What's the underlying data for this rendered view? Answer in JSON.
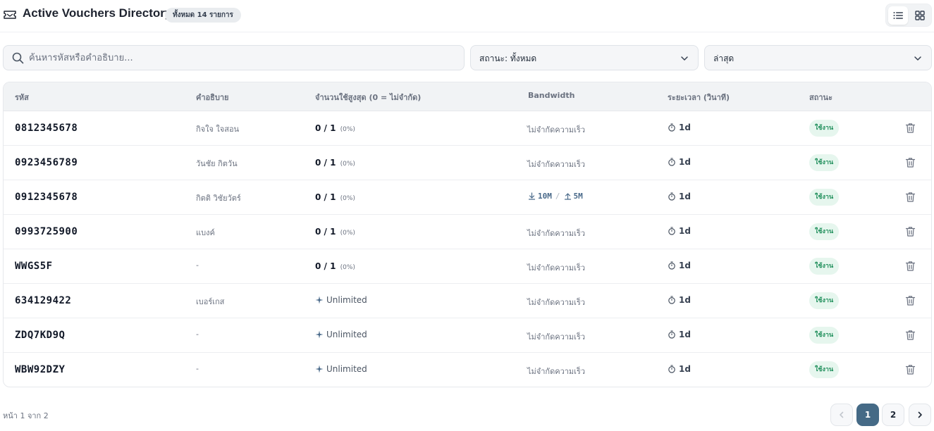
{
  "header": {
    "title": "Active Vouchers Directory",
    "count_badge": "ทั้งหมด 14 รายการ",
    "title_icon": "ticket-icon",
    "view_modes": [
      "list-view-icon",
      "grid-view-icon"
    ],
    "active_view": "list"
  },
  "filters": {
    "search_placeholder": "ค้นหารหัสหรือคำอธิบาย...",
    "search_value": "",
    "status_selected": "สถานะ: ทั้งหมด",
    "sort_selected": "ล่าสุด"
  },
  "table": {
    "columns": [
      "รหัส",
      "คำอธิบาย",
      "จำนวนใช้สูงสุด (0 = ไม่จำกัด)",
      "Bandwidth",
      "ระยะเวลา (วินาที)",
      "สถานะ"
    ],
    "rows": [
      {
        "code": "0812345678",
        "description": "กิจใจ ใจสอน",
        "usage": "0 / 1",
        "usage_pct": "(0%)",
        "bandwidth": "ไม่จำกัดความเร็ว",
        "duration": "1d",
        "status": "ใช้งาน"
      },
      {
        "code": "0923456789",
        "description": "วันชัย กิตวัน",
        "usage": "0 / 1",
        "usage_pct": "(0%)",
        "bandwidth": "ไม่จำกัดความเร็ว",
        "duration": "1d",
        "status": "ใช้งาน"
      },
      {
        "code": "0912345678",
        "description": "กิตติ วิชัยวัตร์",
        "usage": "0 / 1",
        "usage_pct": "(0%)",
        "bandwidth_down": "10M",
        "bandwidth_up": "5M",
        "duration": "1d",
        "status": "ใช้งาน"
      },
      {
        "code": "0993725900",
        "description": "แบงค์",
        "usage": "0 / 1",
        "usage_pct": "(0%)",
        "bandwidth": "ไม่จำกัดความเร็ว",
        "duration": "1d",
        "status": "ใช้งาน"
      },
      {
        "code": "WWGS5F",
        "description": "-",
        "usage": "0 / 1",
        "usage_pct": "(0%)",
        "bandwidth": "ไม่จำกัดความเร็ว",
        "duration": "1d",
        "status": "ใช้งาน"
      },
      {
        "code": "634129422",
        "description": "เบอร์เกส",
        "usage": "Unlimited",
        "bandwidth": "ไม่จำกัดความเร็ว",
        "duration": "1d",
        "status": "ใช้งาน"
      },
      {
        "code": "ZDQ7KD9Q",
        "description": "-",
        "usage": "Unlimited",
        "bandwidth": "ไม่จำกัดความเร็ว",
        "duration": "1d",
        "status": "ใช้งาน"
      },
      {
        "code": "WBW92DZY",
        "description": "-",
        "usage": "Unlimited",
        "bandwidth": "ไม่จำกัดความเร็ว",
        "duration": "1d",
        "status": "ใช้งาน"
      }
    ]
  },
  "pagination": {
    "info": "หน้า 1 จาก 2",
    "pages": [
      "1",
      "2"
    ],
    "current": "1"
  },
  "colors": {
    "accent": "#456a86",
    "active_badge_bg": "#e6f6ee",
    "active_badge_text": "#1e8e5a",
    "bandwidth_limited": "#4a6a8a"
  }
}
